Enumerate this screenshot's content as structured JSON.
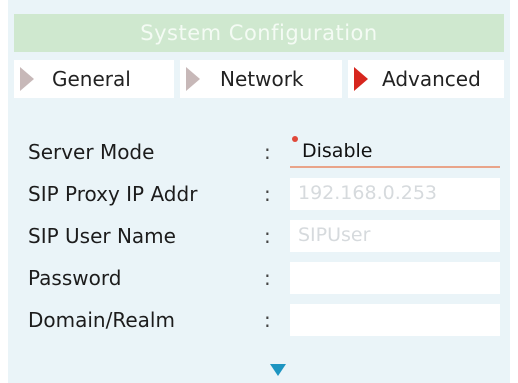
{
  "window": {
    "title": "System Configuration"
  },
  "tabs": [
    {
      "label": "General",
      "active": false
    },
    {
      "label": "Network",
      "active": false
    },
    {
      "label": "Advanced",
      "active": true
    }
  ],
  "form": {
    "rows": [
      {
        "label": "Server Mode",
        "separator": ":",
        "value": "Disable",
        "type": "select"
      },
      {
        "label": "SIP Proxy IP Addr",
        "separator": ":",
        "value": "192.168.0.253",
        "type": "input"
      },
      {
        "label": "SIP User Name",
        "separator": ":",
        "value": "SIPUser",
        "type": "input"
      },
      {
        "label": "Password",
        "separator": ":",
        "value": "",
        "type": "input"
      },
      {
        "label": "Domain/Realm",
        "separator": ":",
        "value": "",
        "type": "input"
      }
    ]
  },
  "icons": {
    "tab_arrow": "triangle-right-icon",
    "scroll": "triangle-down-icon"
  },
  "colors": {
    "title_bg": "#cfe8cf",
    "panel_bg": "#eaf4f8",
    "active_arrow": "#d7261e",
    "inactive_arrow": "#c7b8b8",
    "scroll_arrow": "#1d95c1"
  }
}
